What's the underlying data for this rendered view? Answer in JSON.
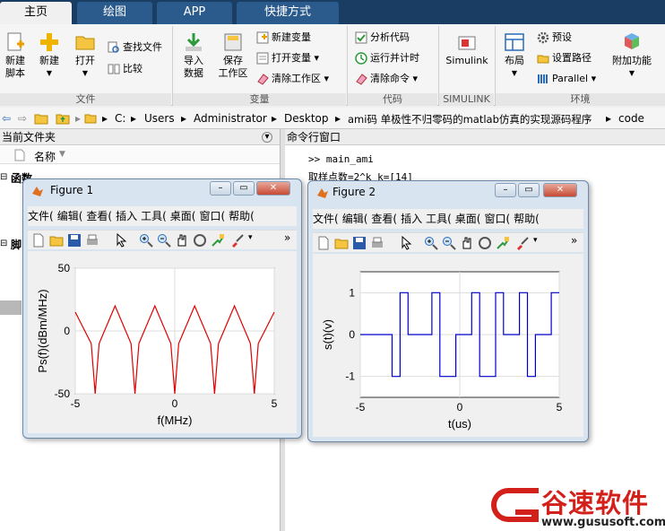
{
  "tabs": [
    "主页",
    "绘图",
    "APP",
    "快捷方式"
  ],
  "ribbon": {
    "file": {
      "label": "文件",
      "new_script": "新建\n脚本",
      "new": "新建",
      "open": "打开",
      "find_files": "查找文件",
      "compare": "比较"
    },
    "variable": {
      "label": "变量",
      "import": "导入\n数据",
      "save_ws": "保存\n工作区",
      "new_var": "新建变量",
      "open_var": "打开变量",
      "clear_ws": "清除工作区"
    },
    "code": {
      "label": "代码",
      "analyze": "分析代码",
      "run_time": "运行并计时",
      "clear_cmd": "清除命令"
    },
    "simulink": {
      "label": "SIMULINK",
      "btn": "Simulink"
    },
    "env": {
      "label": "环境",
      "layout": "布局",
      "preferences": "预设",
      "set_path": "设置路径",
      "parallel": "Parallel",
      "addons": "附加功能"
    }
  },
  "address": {
    "path": [
      "C:",
      "Users",
      "Administrator",
      "Desktop",
      "ami码 单极性不归零码的matlab仿真的实现源码程序",
      "code"
    ]
  },
  "left_panel": {
    "title": "当前文件夹",
    "col_name": "名称",
    "group1": "函数",
    "group2": "脚"
  },
  "cmd": {
    "title": "命令行窗口",
    "line1": ">> main_ami",
    "line2": "取样点数=2^k k=[14]"
  },
  "fig1": {
    "title": "Figure 1",
    "menus": [
      "文件(",
      "编辑(",
      "查看(",
      "插入",
      "工具(",
      "桌面(",
      "窗口(",
      "帮助("
    ],
    "ylabel": "Ps(f)(dBm/MHz)",
    "xlabel": "f(MHz)",
    "yticks": [
      "50",
      "0",
      "-50"
    ],
    "xticks": [
      "-5",
      "0",
      "5"
    ],
    "series_color": "#e00000"
  },
  "fig2": {
    "title": "Figure 2",
    "menus": [
      "文件(",
      "编辑(",
      "查看(",
      "插入",
      "工具(",
      "桌面(",
      "窗口(",
      "帮助("
    ],
    "ylabel": "s(t)(v)",
    "xlabel": "t(us)",
    "yticks": [
      "1",
      "0",
      "-1"
    ],
    "xticks": [
      "-5",
      "0",
      "5"
    ],
    "series_color": "#0000cc"
  },
  "watermark": {
    "brand": "谷速软件",
    "url": "www.gususoft.com",
    "color": "#d3201b"
  },
  "chart_data": [
    {
      "type": "line",
      "x": [
        -5,
        -4.2,
        -4,
        -3.8,
        -3,
        -2.2,
        -2,
        -1.8,
        -1,
        -0.2,
        0,
        0.2,
        1,
        1.8,
        2,
        2.2,
        3,
        3.8,
        4,
        4.2,
        5
      ],
      "values": [
        15,
        -10,
        -50,
        -10,
        20,
        -10,
        -50,
        -10,
        20,
        -10,
        -50,
        -10,
        20,
        -10,
        -50,
        -10,
        20,
        -10,
        -50,
        -10,
        15
      ],
      "xlim": [
        -5,
        5
      ],
      "ylim": [
        -50,
        50
      ]
    },
    {
      "type": "line",
      "x": [
        -5,
        -3.4,
        -3.4,
        -3,
        -3,
        -2.6,
        -2.6,
        -1.4,
        -1.4,
        -1,
        -1,
        -0.2,
        -0.2,
        0.6,
        0.6,
        1,
        1,
        1.8,
        1.8,
        2.2,
        2.2,
        3,
        3,
        3.4,
        3.4,
        3.8,
        3.8,
        4.6,
        4.6,
        5,
        5
      ],
      "values": [
        0,
        0,
        -1,
        -1,
        1,
        1,
        0,
        0,
        1,
        1,
        -1,
        -1,
        0,
        0,
        1,
        1,
        -1,
        -1,
        1,
        1,
        0,
        0,
        1,
        1,
        -1,
        -1,
        0,
        0,
        1,
        1,
        1
      ],
      "xlim": [
        -5,
        5
      ],
      "ylim": [
        -1.5,
        1.5
      ]
    }
  ]
}
